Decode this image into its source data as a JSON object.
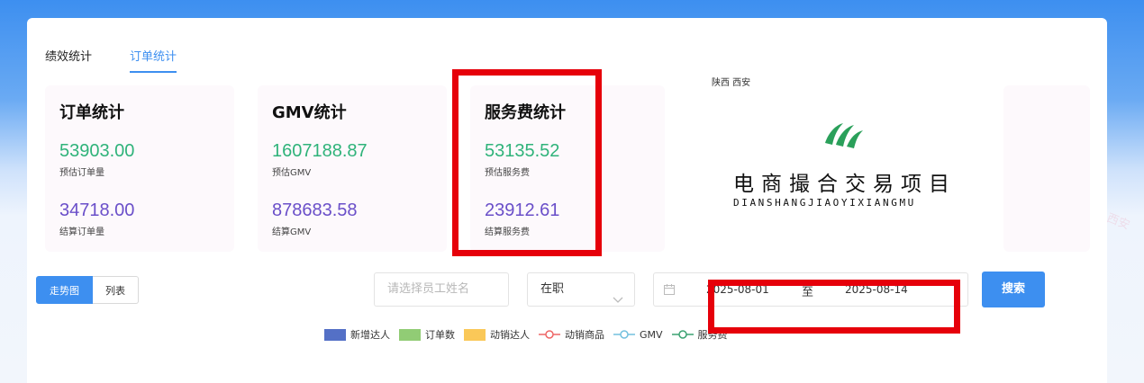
{
  "tabs": [
    {
      "label": "绩效统计",
      "active": false
    },
    {
      "label": "订单统计",
      "active": true
    }
  ],
  "stats": {
    "orders": {
      "title": "订单统计",
      "value1": "53903.00",
      "label1": "预估订单量",
      "value2": "34718.00",
      "label2": "结算订单量"
    },
    "gmv": {
      "title": "GMV统计",
      "value1": "1607188.87",
      "label1": "预估GMV",
      "value2": "878683.58",
      "label2": "结算GMV"
    },
    "service": {
      "title": "服务费统计",
      "value1": "53135.52",
      "label1": "预估服务费",
      "value2": "23912.61",
      "label2": "结算服务费"
    }
  },
  "brand": {
    "region": "陕西 西安",
    "title": "电商撮合交易项目",
    "subtitle": "DIANSHANGJIAOYIXIANGMU",
    "color": "#2aa05a"
  },
  "view_toggle": {
    "chart_label": "走势图",
    "list_label": "列表"
  },
  "filters": {
    "employee_placeholder": "请选择员工姓名",
    "status_value": "在职",
    "date_start": "2025-08-01",
    "date_sep": "至",
    "date_end": "2025-08-14",
    "search_label": "搜索"
  },
  "legend": [
    {
      "label": "新增达人",
      "kind": "bar",
      "color": "#5470c6"
    },
    {
      "label": "订单数",
      "kind": "bar",
      "color": "#91cc75"
    },
    {
      "label": "动销达人",
      "kind": "bar",
      "color": "#fac858"
    },
    {
      "label": "动销商品",
      "kind": "line",
      "color": "#ee6666"
    },
    {
      "label": "GMV",
      "kind": "line",
      "color": "#73c0de"
    },
    {
      "label": "服务费",
      "kind": "line",
      "color": "#3ba272"
    }
  ],
  "watermark_text": "陕西 西安",
  "colors": {
    "accent": "#3d8ff0",
    "value_green": "#2fb37a",
    "value_purple": "#6a4fc9",
    "highlight_red": "#e6000a"
  }
}
